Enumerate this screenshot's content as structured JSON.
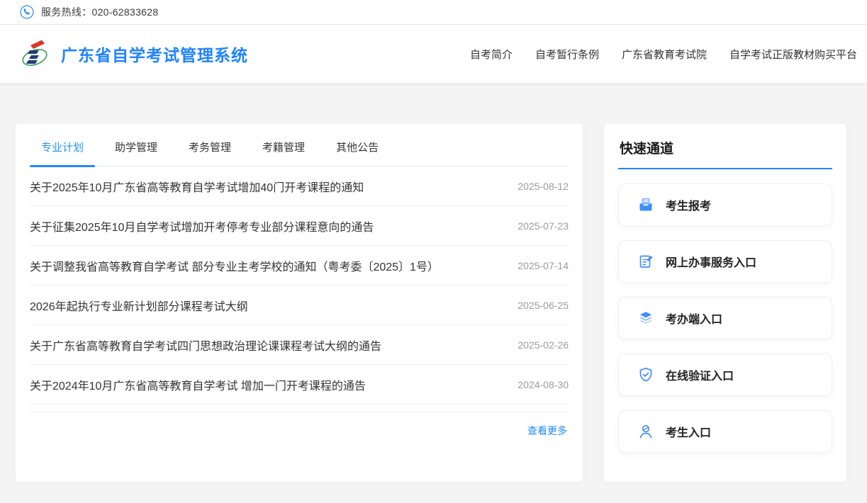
{
  "topbar": {
    "hotline": "服务热线：020-62833628"
  },
  "header": {
    "title": "广东省自学考试管理系统",
    "nav": [
      "自考简介",
      "自考暂行条例",
      "广东省教育考试院",
      "自学考试正版教材购买平台"
    ]
  },
  "notices": {
    "tabs": [
      "专业计划",
      "助学管理",
      "考务管理",
      "考籍管理",
      "其他公告"
    ],
    "active_tab": "专业计划",
    "items": [
      {
        "title": "关于2025年10月广东省高等教育自学考试增加40门开考课程的通知",
        "date": "2025-08-12"
      },
      {
        "title": "关于征集2025年10月自学考试增加开考停考专业部分课程意向的通告",
        "date": "2025-07-23"
      },
      {
        "title": "关于调整我省高等教育自学考试 部分专业主考学校的通知（粤考委〔2025〕1号）",
        "date": "2025-07-14"
      },
      {
        "title": "2026年起执行专业新计划部分课程考试大纲",
        "date": "2025-06-25"
      },
      {
        "title": "关于广东省高等教育自学考试四门思想政治理论课课程考试大纲的通告",
        "date": "2025-02-26"
      },
      {
        "title": "关于2024年10月广东省高等教育自学考试 增加一门开考课程的通告",
        "date": "2024-08-30"
      }
    ],
    "more": "查看更多"
  },
  "quick": {
    "title": "快速通道",
    "items": [
      {
        "label": "考生报考",
        "icon": "inbox-icon"
      },
      {
        "label": "网上办事服务入口",
        "icon": "edit-document-icon"
      },
      {
        "label": "考办端入口",
        "icon": "layers-icon"
      },
      {
        "label": "在线验证入口",
        "icon": "shield-check-icon"
      },
      {
        "label": "考生入口",
        "icon": "user-icon"
      }
    ]
  },
  "colors": {
    "brand_blue": "#1f83ff",
    "link_blue": "#2188ff",
    "icon_blue": "#3e8ef7",
    "logo_red": "#d9372a",
    "logo_navy": "#1c3f77",
    "logo_green": "#2e9e4f",
    "date_gray": "#9b9b9b"
  }
}
